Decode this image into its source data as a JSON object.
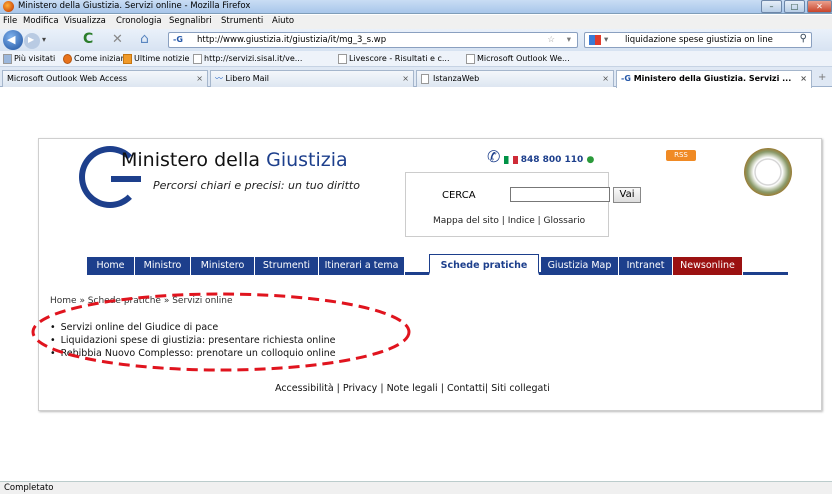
{
  "window": {
    "title": "Ministero della Giustizia. Servizi online - Mozilla Firefox"
  },
  "menubar": {
    "items": [
      "File",
      "Modifica",
      "Visualizza",
      "Cronologia",
      "Segnalibri",
      "Strumenti",
      "Aiuto"
    ]
  },
  "navbar": {
    "url": "http://www.giustizia.it/giustizia/it/mg_3_s.wp",
    "search_value": "liquidazione spese giustizia on line"
  },
  "bookmarks": [
    "Più visitati",
    "Come iniziare",
    "Ultime notizie",
    "http://servizi.sisal.it/ve...",
    "Livescore - Risultati e c...",
    "Microsoft Outlook We..."
  ],
  "tabs": [
    {
      "label": "Microsoft Outlook Web Access"
    },
    {
      "label": "Libero Mail"
    },
    {
      "label": "IstanzaWeb"
    },
    {
      "label": "Ministero della Giustizia. Servizi ..."
    }
  ],
  "site": {
    "title_part1": "Ministero della ",
    "title_part2": "Giustizia",
    "tagline": "Percorsi chiari e precisi: un tuo diritto",
    "phone": "848 800 110",
    "rss": "RSS",
    "search_label": "CERCA",
    "search_button": "Vai",
    "links": [
      "Mappa del sito",
      "Indice",
      "Glossario"
    ],
    "nav": [
      "Home",
      "Ministro",
      "Ministero",
      "Strumenti",
      "Itinerari a tema",
      "Schede pratiche",
      "Giustizia Map",
      "Intranet",
      "Newsonline"
    ],
    "breadcrumb": "Home » Schede pratiche » Servizi online",
    "services": [
      "Servizi online del Giudice di pace",
      "Liquidazioni spese di giustizia: presentare richiesta online",
      "Rebibbia Nuovo Complesso: prenotare un colloquio online"
    ],
    "footer": [
      "Accessibilità",
      "Privacy",
      "Note legali",
      "Contatti",
      "Siti collegati"
    ]
  },
  "status": "Completato",
  "colors": {
    "brand_blue": "#1d3f8c",
    "news_red": "#9b1111",
    "annotation_red": "#e0141e"
  }
}
